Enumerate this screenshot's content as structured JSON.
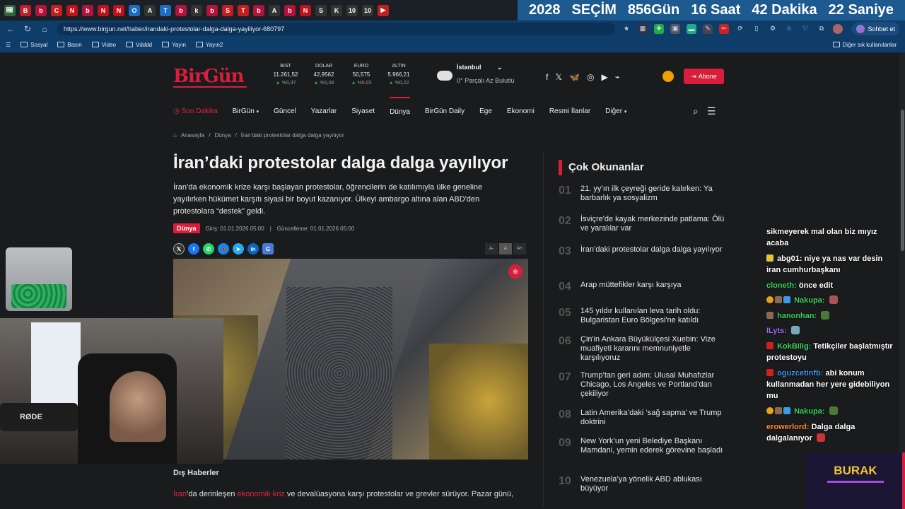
{
  "tabs": [
    {
      "icon": "📰",
      "color": "#2a6a3a"
    },
    {
      "icon": "B",
      "color": "#c01d2c"
    },
    {
      "icon": "b",
      "color": "#b2133a"
    },
    {
      "icon": "C",
      "color": "#c11f1f"
    },
    {
      "icon": "N",
      "color": "#c0101a"
    },
    {
      "icon": "b",
      "color": "#b2133a"
    },
    {
      "icon": "N",
      "color": "#c0101a"
    },
    {
      "icon": "N",
      "color": "#c0101a"
    },
    {
      "icon": "O",
      "color": "#1a6cc4"
    },
    {
      "icon": "A",
      "color": "#333"
    },
    {
      "icon": "T",
      "color": "#1a6cc4"
    },
    {
      "icon": "b",
      "color": "#b2133a"
    },
    {
      "icon": "k",
      "color": "#333"
    },
    {
      "icon": "b",
      "color": "#b2133a"
    },
    {
      "icon": "S",
      "color": "#c11f1f"
    },
    {
      "icon": "T",
      "color": "#c11f1f"
    },
    {
      "icon": "b",
      "color": "#b2133a"
    },
    {
      "icon": "A",
      "color": "#333"
    },
    {
      "icon": "b",
      "color": "#b2133a"
    },
    {
      "icon": "N",
      "color": "#c0101a"
    },
    {
      "icon": "S",
      "color": "#333"
    },
    {
      "icon": "K",
      "color": "#333"
    },
    {
      "icon": "10",
      "color": "#333"
    },
    {
      "icon": "10",
      "color": "#333"
    },
    {
      "icon": "▶",
      "color": "#c11f1f"
    }
  ],
  "countdown": {
    "year": "2028",
    "label": "SEÇİM",
    "days": "856Gün",
    "hours": "16 Saat",
    "minutes": "42 Dakika",
    "seconds": "22 Saniye"
  },
  "address": {
    "url": "https://www.birgun.net/haber/irandaki-protestolar-dalga-dalga-yayiliyor-680797",
    "chat_label": "Sohbet et"
  },
  "bookmarks": {
    "items": [
      "Sosyal",
      "Basın",
      "Video",
      "Vdddd",
      "Yayın",
      "Yayın2"
    ],
    "other": "Diğer sık kullanılanlar"
  },
  "site": {
    "logo": "BirGün",
    "markets": [
      {
        "name": "BIST",
        "value": "11.261,52",
        "change": "%0,37"
      },
      {
        "name": "DOLAR",
        "value": "42,9562",
        "change": "%0,08"
      },
      {
        "name": "EURO",
        "value": "50,575",
        "change": "%0,03"
      },
      {
        "name": "ALTIN",
        "value": "5.966,21",
        "change": "%0,22"
      }
    ],
    "weather": {
      "city": "İstanbul",
      "desc": "0° Parçalı Az Bulutlu"
    },
    "subscribe": "Abone",
    "nav": [
      "Son Dakika",
      "BirGün",
      "Güncel",
      "Yazarlar",
      "Siyaset",
      "Dünya",
      "BirGün Daily",
      "Ege",
      "Ekonomi",
      "Resmi İlanlar",
      "Diğer"
    ]
  },
  "breadcrumb": [
    "Anasayfa",
    "/",
    "Dünya",
    "/",
    "İran’daki protestolar dalga dalga yayılıyor"
  ],
  "article": {
    "title": "İran’daki protestolar dalga dalga yayılıyor",
    "lead": "İran’da ekonomik krize karşı başlayan protestolar, öğrencilerin de katılımıyla ülke geneline yayılırken hükümet karşıtı siyasi bir boyut kazanıyor. Ülkeyi ambargo altına alan ABD'den protestolara “destek” geldi.",
    "category": "Dünya",
    "published": "Giriş: 01.01.2026 05:00",
    "separator": "|",
    "updated": "Güncelleme: 01.01.2026 05:00",
    "font_controls": [
      "A-",
      "A",
      "A+"
    ],
    "section": "Dış Haberler",
    "body": {
      "link1": "İran",
      "text1": "’da derinleşen ",
      "link2": "ekonomik kriz",
      "text2": " ve devalüasyona karşı protestolar ve grevler sürüyor. Pazar günü,"
    }
  },
  "popular": {
    "title": "Çok Okunanlar",
    "items": [
      {
        "num": "01",
        "text": "21. yy’ın ilk çeyreği geride kalırken: Ya barbarlık ya sosyalizm"
      },
      {
        "num": "02",
        "text": "İsviçre'de kayak merkezinde patlama: Ölü ve yaralılar var"
      },
      {
        "num": "03",
        "text": "İran’daki protestolar dalga dalga yayılıyor"
      },
      {
        "num": "04",
        "text": "Arap müttefikler karşı karşıya"
      },
      {
        "num": "05",
        "text": "145 yıldır kullanılan leva tarih oldu: Bulgaristan Euro Bölgesi'ne katıldı"
      },
      {
        "num": "06",
        "text": "Çin'in Ankara Büyükülçesi Xuebin: Vize muafiyeti kararını memnuniyetle karşılıyoruz"
      },
      {
        "num": "07",
        "text": "Trump’tan geri adım: Ulusal Muhafızlar Chicago, Los Angeles ve Portland’dan çekiliyor"
      },
      {
        "num": "08",
        "text": "Latin Amerika’daki ‘sağ sapma’ ve Trump doktrini"
      },
      {
        "num": "09",
        "text": "New York’un yeni Belediye Başkanı Mamdani, yemin ederek görevine başladı"
      },
      {
        "num": "10",
        "text": "Venezuela’ya yönelik ABD ablukası büyüyor"
      }
    ]
  },
  "overlay": {
    "mic_label": "RØDE",
    "brand": "BURAK"
  },
  "chat": [
    {
      "user": "",
      "color": "#ffffff",
      "text": "sikmeyerek mal olan biz mıyız acaba"
    },
    {
      "user": "abg01:",
      "color": "#ffffff",
      "text": "niye ya nas var desin iran cumhurbaşkanı"
    },
    {
      "user": "cloneth:",
      "color": "#3ad15a",
      "text": "önce edit"
    },
    {
      "user": "Nakupa:",
      "color": "#3ad15a",
      "text": ""
    },
    {
      "user": "hanonhan:",
      "color": "#3ad15a",
      "text": ""
    },
    {
      "user": "ILyts:",
      "color": "#a06cf0",
      "text": ""
    },
    {
      "user": "KokBilig:",
      "color": "#3ad15a",
      "text": "Tetikçiler başlatmıştır protestoyu"
    },
    {
      "user": "oguzcetinfb:",
      "color": "#3a8fe8",
      "text": "abi konum kullanmadan her yere gidebiliyon mu"
    },
    {
      "user": "Nakupa:",
      "color": "#3ad15a",
      "text": ""
    },
    {
      "user": "erowerlord:",
      "color": "#ff8a3a",
      "text": "Dalga dalga dalgalanıyor"
    }
  ]
}
